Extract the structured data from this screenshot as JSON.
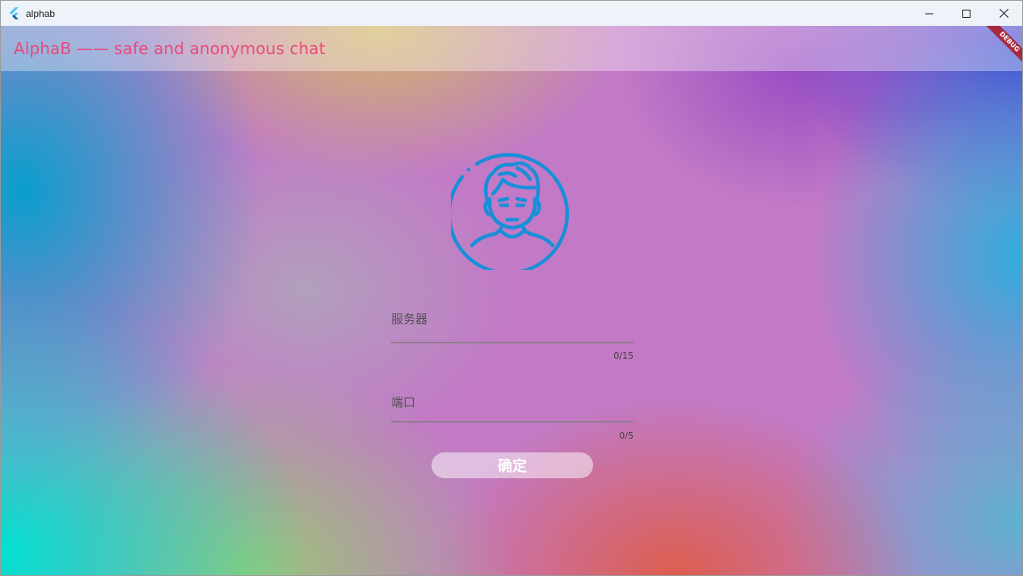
{
  "window": {
    "title": "alphab"
  },
  "appbar": {
    "title": "AlphaB —— safe and anonymous chat",
    "debug_label": "DEBUG"
  },
  "form": {
    "server_label": "服务器",
    "server_counter": "0/15",
    "port_label": "端口",
    "port_counter": "0/5",
    "confirm_label": "确定"
  },
  "icons": {
    "app": "flutter-logo-icon",
    "avatar": "user-avatar-icon",
    "minimize": "minimize-icon",
    "maximize": "maximize-icon",
    "close": "close-icon"
  },
  "colors": {
    "appbar_title": "#e84a7b",
    "avatar_stroke": "#1a8fd8",
    "debug_banner": "#a52a3f"
  }
}
